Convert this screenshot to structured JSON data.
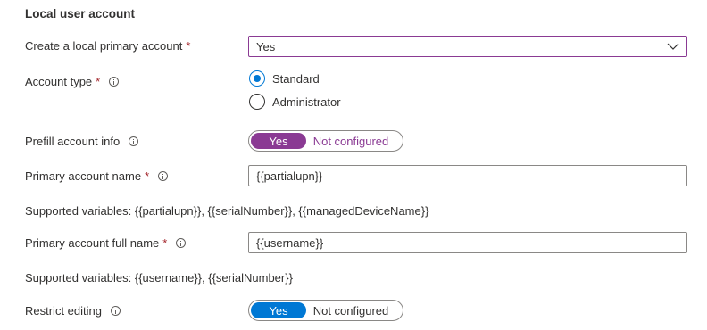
{
  "section": {
    "title": "Local user account"
  },
  "create_primary": {
    "label": "Create a local primary account",
    "required": "*",
    "value": "Yes"
  },
  "account_type": {
    "label": "Account type",
    "required": "*",
    "options": [
      {
        "label": "Standard",
        "selected": true
      },
      {
        "label": "Administrator",
        "selected": false
      }
    ]
  },
  "prefill": {
    "label": "Prefill account info",
    "on_label": "Yes",
    "off_label": "Not configured",
    "selected": "Yes"
  },
  "primary_name": {
    "label": "Primary account name",
    "required": "*",
    "value": "{{partialupn}}"
  },
  "primary_name_help": "Supported variables: {{partialupn}}, {{serialNumber}}, {{managedDeviceName}}",
  "full_name": {
    "label": "Primary account full name",
    "required": "*",
    "value": "{{username}}"
  },
  "full_name_help": "Supported variables: {{username}}, {{serialNumber}}",
  "restrict": {
    "label": "Restrict editing",
    "on_label": "Yes",
    "off_label": "Not configured",
    "selected": "Yes"
  },
  "colors": {
    "accent_purple": "#8a3a93",
    "accent_blue": "#0078d4",
    "required_red": "#a4262c"
  }
}
